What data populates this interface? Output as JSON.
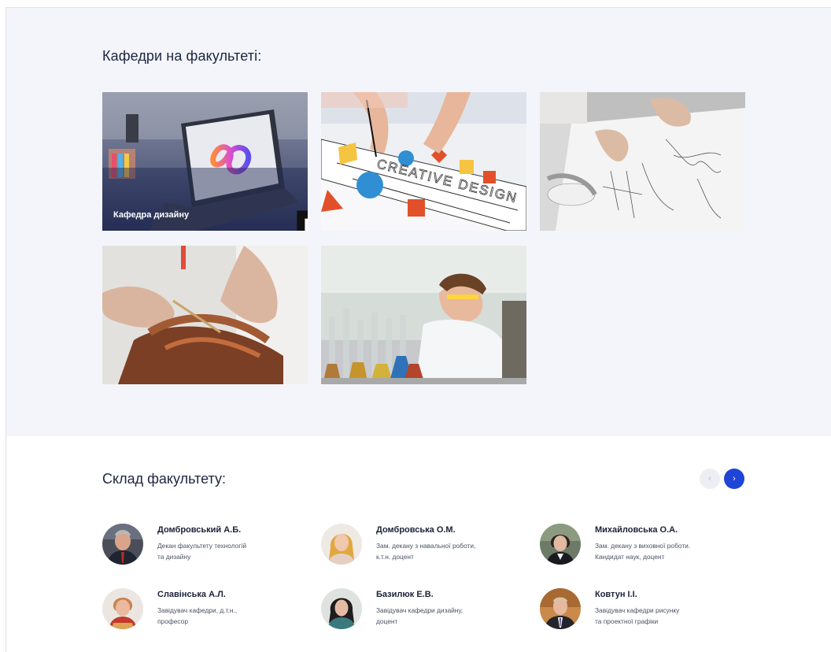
{
  "departments": {
    "title": "Кафедри на факультеті:",
    "tiles": [
      {
        "caption": "Кафедра дизайну",
        "image": "laptop-design-photo"
      },
      {
        "caption": "",
        "image": "creative-design-photo",
        "overlay_text": "CREATIVE DESIGN"
      },
      {
        "caption": "",
        "image": "fashion-sketch-photo"
      },
      {
        "caption": "",
        "image": "leather-craft-photo"
      },
      {
        "caption": "",
        "image": "chemistry-lab-photo"
      }
    ]
  },
  "staff": {
    "title": "Склад факультету:",
    "prev_icon": "‹",
    "next_icon": "›",
    "people": [
      {
        "name": "Домбровський А.Б.",
        "role_line1": "Декан факультету технологій",
        "role_line2": "та дизайну"
      },
      {
        "name": "Домбровська О.М.",
        "role_line1": "Зам. декану з навальної роботи,",
        "role_line2": "к.т.н. доцент"
      },
      {
        "name": "Михайловська О.А.",
        "role_line1": "Зам. декану з виховної роботи.",
        "role_line2": "Кандидат наук, доцент"
      },
      {
        "name": "Славінська А.Л.",
        "role_line1": "Завідувач кафедри, д.т.н.,",
        "role_line2": "професор"
      },
      {
        "name": "Базилюк Е.В.",
        "role_line1": "Завідувач кафедри дизайну,",
        "role_line2": "доцент"
      },
      {
        "name": "Ковтун І.І.",
        "role_line1": "Завідувач кафедри рисунку",
        "role_line2": "та проектної графіки"
      }
    ]
  },
  "colors": {
    "section_bg": "#f4f5fa",
    "accent": "#1f45d6",
    "title": "#1c2641"
  }
}
